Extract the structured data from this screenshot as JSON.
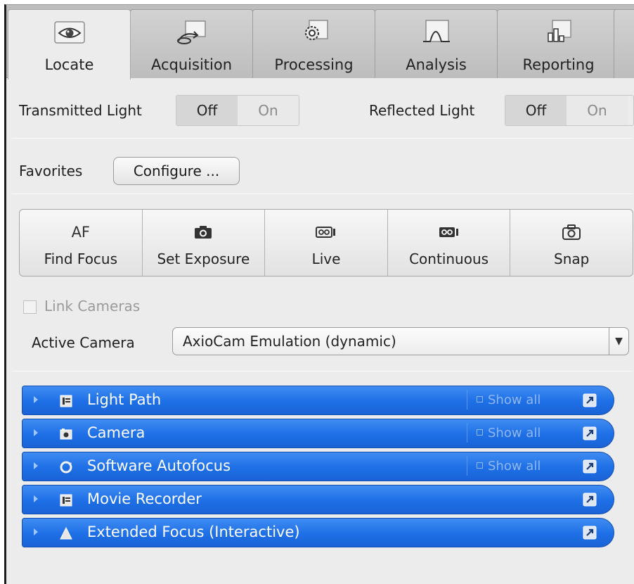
{
  "tabs": [
    {
      "label": "Locate",
      "icon": "eye-icon",
      "active": true
    },
    {
      "label": "Acquisition",
      "icon": "acquisition-icon",
      "active": false
    },
    {
      "label": "Processing",
      "icon": "gear-icon",
      "active": false
    },
    {
      "label": "Analysis",
      "icon": "peak-icon",
      "active": false
    },
    {
      "label": "Reporting",
      "icon": "bar-chart-icon",
      "active": false
    }
  ],
  "lights": {
    "transmitted_label": "Transmitted Light",
    "reflected_label": "Reflected Light",
    "off_label": "Off",
    "on_label": "On",
    "transmitted_state": "Off",
    "reflected_state": "Off"
  },
  "favorites": {
    "label": "Favorites",
    "configure_label": "Configure ..."
  },
  "actions": [
    {
      "label": "Find Focus",
      "icon_text": "AF",
      "icon": "autofocus-icon"
    },
    {
      "label": "Set Exposure",
      "icon": "camera-icon"
    },
    {
      "label": "Live",
      "icon": "live-camera-icon"
    },
    {
      "label": "Continuous",
      "icon": "video-camera-icon"
    },
    {
      "label": "Snap",
      "icon": "snap-camera-icon"
    }
  ],
  "cameras": {
    "link_label": "Link Cameras",
    "link_checked": false,
    "active_label": "Active Camera",
    "active_value": "AxioCam Emulation (dynamic)"
  },
  "tools": [
    {
      "title": "Light Path",
      "icon": "panel-icon",
      "show_all": "Show all"
    },
    {
      "title": "Camera",
      "icon": "camera-icon",
      "show_all": "Show all"
    },
    {
      "title": "Software Autofocus",
      "icon": "refresh-icon",
      "show_all": "Show all"
    },
    {
      "title": "Movie Recorder",
      "icon": "panel-icon",
      "show_all": ""
    },
    {
      "title": "Extended Focus (Interactive)",
      "icon": "triangle-icon",
      "show_all": ""
    }
  ],
  "colors": {
    "tool_bar_blue": "#1e6fe6",
    "panel_background": "#ececec",
    "tab_strip": "#bdbdbd"
  }
}
